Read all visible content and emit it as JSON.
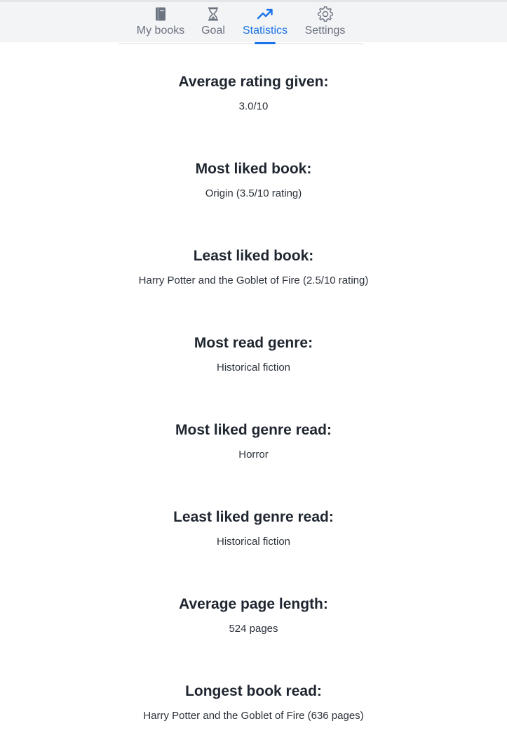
{
  "nav": {
    "tabs": [
      {
        "label": "My books",
        "icon": "book-icon"
      },
      {
        "label": "Goal",
        "icon": "hourglass-icon"
      },
      {
        "label": "Statistics",
        "icon": "trending-up-icon"
      },
      {
        "label": "Settings",
        "icon": "gear-icon"
      }
    ],
    "active_color": "#1a73e8",
    "inactive_color": "#6b7280"
  },
  "stats": [
    {
      "heading": "Average rating given:",
      "value": "3.0/10"
    },
    {
      "heading": "Most liked book:",
      "value": "Origin (3.5/10 rating)"
    },
    {
      "heading": "Least liked book:",
      "value": "Harry Potter and the Goblet of Fire (2.5/10 rating)"
    },
    {
      "heading": "Most read genre:",
      "value": "Historical fiction"
    },
    {
      "heading": "Most liked genre read:",
      "value": "Horror"
    },
    {
      "heading": "Least liked genre read:",
      "value": "Historical fiction"
    },
    {
      "heading": "Average page length:",
      "value": "524 pages"
    },
    {
      "heading": "Longest book read:",
      "value": "Harry Potter and the Goblet of Fire (636 pages)"
    }
  ]
}
